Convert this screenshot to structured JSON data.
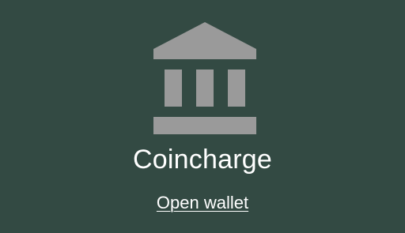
{
  "app": {
    "name": "Coincharge",
    "icon": "bank-icon"
  },
  "actions": {
    "open_wallet_label": "Open wallet"
  },
  "colors": {
    "background": "#334a43",
    "icon": "#9a9a9a",
    "text": "#ffffff"
  }
}
